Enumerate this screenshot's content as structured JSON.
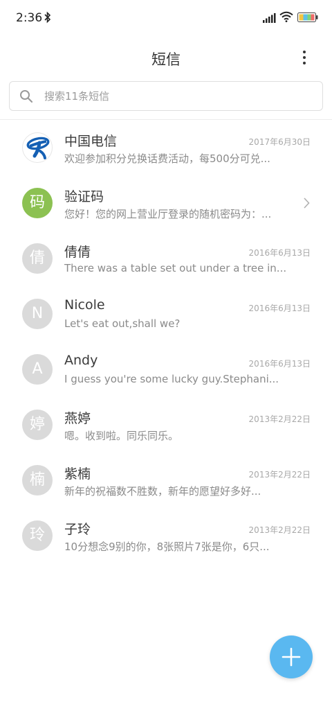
{
  "status_bar": {
    "time": "2:36",
    "icons": [
      "bluetooth-icon",
      "signal-icon",
      "wifi-icon",
      "battery-icon"
    ]
  },
  "header": {
    "title": "短信",
    "menu_icon": "more-vertical-icon"
  },
  "search": {
    "placeholder": "搜索11条短信",
    "value": ""
  },
  "threads": [
    {
      "name": "中国电信",
      "preview": "欢迎参加积分兑换话费活动，每500分可兑...",
      "date": "2017年6月30日",
      "avatar": "",
      "avatar_type": "logo"
    },
    {
      "name": "验证码",
      "preview": "您好！您的网上营业厅登录的随机密码为：...",
      "date": "",
      "avatar": "码",
      "avatar_type": "green",
      "has_chevron": true
    },
    {
      "name": "倩倩",
      "preview": "There was a table set out under a tree in...",
      "date": "2016年6月13日",
      "avatar": "倩",
      "avatar_type": "gray"
    },
    {
      "name": "Nicole",
      "preview": "Let's eat out,shall we?",
      "date": "2016年6月13日",
      "avatar": "N",
      "avatar_type": "gray"
    },
    {
      "name": "Andy",
      "preview": "I guess you're some lucky guy.Stephani...",
      "date": "2016年6月13日",
      "avatar": "A",
      "avatar_type": "gray"
    },
    {
      "name": "燕婷",
      "preview": "嗯。收到啦。同乐同乐。",
      "date": "2013年2月22日",
      "avatar": "婷",
      "avatar_type": "gray"
    },
    {
      "name": "紫楠",
      "preview": "新年的祝福数不胜数，新年的愿望好多好...",
      "date": "2013年2月22日",
      "avatar": "楠",
      "avatar_type": "gray"
    },
    {
      "name": "子玲",
      "preview": "10分想念9别的你，8张照片7张是你，6只...",
      "date": "2013年2月22日",
      "avatar": "玲",
      "avatar_type": "gray"
    }
  ],
  "fab": {
    "icon": "plus-icon"
  },
  "colors": {
    "accent": "#5ab8f0",
    "avatar_green": "#8cc152",
    "avatar_gray": "#dadada",
    "telecom_blue": "#1560b4"
  }
}
